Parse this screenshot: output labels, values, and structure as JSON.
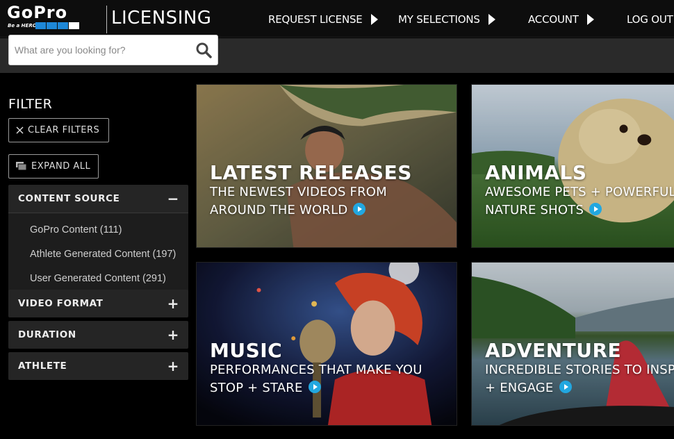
{
  "header": {
    "logo_word": "GoPro",
    "logo_tagline": "Be a HERO.",
    "section_title": "LICENSING",
    "nav": [
      {
        "label": "REQUEST LICENSE"
      },
      {
        "label": "MY SELECTIONS"
      },
      {
        "label": "ACCOUNT"
      },
      {
        "label": "LOG OUT"
      }
    ]
  },
  "search": {
    "placeholder": "What are you looking for?",
    "value": ""
  },
  "sidebar": {
    "filter_title": "FILTER",
    "clear_filters": "CLEAR FILTERS",
    "expand_all": "EXPAND ALL",
    "sections": [
      {
        "title": "CONTENT SOURCE",
        "toggle": "−",
        "expanded": true,
        "items": [
          "GoPro Content (111)",
          "Athlete Generated Content (197)",
          "User Generated Content (291)"
        ]
      },
      {
        "title": "VIDEO FORMAT",
        "toggle": "+",
        "expanded": false
      },
      {
        "title": "DURATION",
        "toggle": "+",
        "expanded": false
      },
      {
        "title": "ATHLETE",
        "toggle": "+",
        "expanded": false
      }
    ]
  },
  "tiles": [
    {
      "title": "LATEST RELEASES",
      "line1": "THE NEWEST VIDEOS FROM",
      "line2": "AROUND THE WORLD"
    },
    {
      "title": "ANIMALS",
      "line1": "AWESOME PETS + POWERFUL",
      "line2": "NATURE SHOTS"
    },
    {
      "title": "MUSIC",
      "line1": "PERFORMANCES THAT MAKE YOU",
      "line2": "STOP + STARE"
    },
    {
      "title": "ADVENTURE",
      "line1": "INCREDIBLE STORIES TO INSPIRE",
      "line2": "+ ENGAGE"
    }
  ],
  "colors": {
    "brand_blue": "#1e88d8",
    "play_blue": "#22a7e0",
    "topbar": "#0d0d0d",
    "search_band": "#2a2a2a",
    "accordion": "#252525"
  },
  "icons": {
    "search": "magnifier",
    "clear": "x",
    "expand": "stacked-cards",
    "nav_arrow": "triangle-right",
    "play": "play-circle"
  }
}
